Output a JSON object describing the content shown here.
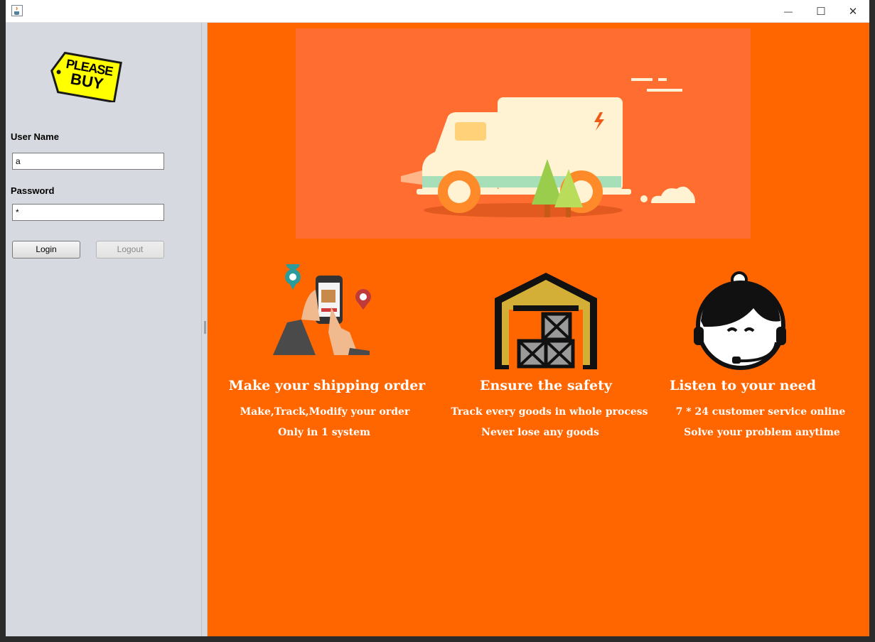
{
  "window": {
    "title": "",
    "icon": "java-cup-icon",
    "controls": {
      "minimize": "—",
      "maximize": "☐",
      "close": "✕"
    }
  },
  "logo": {
    "line1": "PLEASE",
    "line2": "BUY",
    "color": "#ffff00"
  },
  "login": {
    "username_label": "User Name",
    "username_value": "a",
    "password_label": "Password",
    "password_value": "*",
    "login_button": "Login",
    "logout_button": "Logout"
  },
  "colors": {
    "brand": "#ff6600",
    "panel": "#d6d9df",
    "banner": "#ff6e30"
  },
  "features": [
    {
      "icon": "phone-tracking-icon",
      "title": "Make your shipping order",
      "line1": "Make,Track,Modify your order",
      "line2": "Only in 1 system"
    },
    {
      "icon": "warehouse-icon",
      "title": "Ensure the safety",
      "line1": "Track every goods in whole process",
      "line2": "Never lose any goods"
    },
    {
      "icon": "customer-service-icon",
      "title": "Listen to your need",
      "line1": "7 * 24 customer service online",
      "line2": "Solve your problem anytime"
    }
  ]
}
